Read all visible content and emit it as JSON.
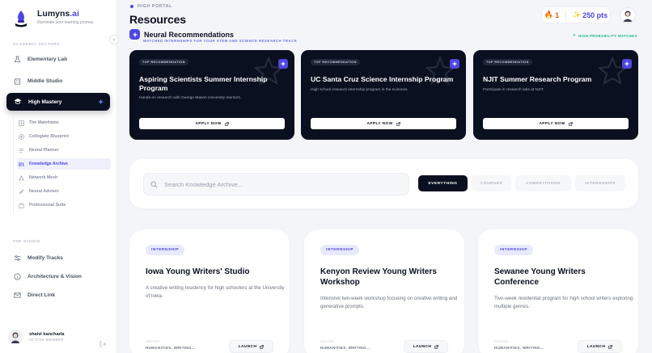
{
  "brand": {
    "name": "Lumyns",
    "name_suffix": ".ai",
    "tagline": "Illuminate your learning journey"
  },
  "sidebar": {
    "section_academic": "ACADEMIC SECTORS",
    "items": [
      {
        "label": "Elementary Lab",
        "icon": "flask-icon"
      },
      {
        "label": "Middle Studio",
        "icon": "building-icon"
      },
      {
        "label": "High Mastery",
        "icon": "graduation-cap-icon"
      }
    ],
    "sub_items": [
      {
        "label": "The Mainframe",
        "icon": "grid-icon"
      },
      {
        "label": "Collegiate Blueprint",
        "icon": "target-icon"
      },
      {
        "label": "Neural Planner",
        "icon": "lines-icon"
      },
      {
        "label": "Knowledge Archive",
        "icon": "books-icon"
      },
      {
        "label": "Network Mesh",
        "icon": "network-icon"
      },
      {
        "label": "Neural Advisor",
        "icon": "compass-icon"
      },
      {
        "label": "Professional Suite",
        "icon": "briefcase-icon"
      }
    ],
    "section_studio": "THE STUDIO",
    "studio_items": [
      {
        "label": "Modify Tracks",
        "icon": "sliders-icon"
      },
      {
        "label": "Architecture & Vision",
        "icon": "info-icon"
      },
      {
        "label": "Direct Link",
        "icon": "mail-icon"
      }
    ],
    "user": {
      "name": "shaivi kancharla",
      "role": "ACTIVE MEMBER"
    }
  },
  "header": {
    "breadcrumb": "HIGH PORTAL",
    "title": "Resources",
    "streak": "1",
    "points": "250 pts"
  },
  "recommendations": {
    "title": "Neural Recommendations",
    "subtitle": "MATCHED INTERNSHIPS FOR YOUR STEM AND SCIENCE RESEARCH TRACK",
    "probability_tag": "HIGH PROBABILITY MATCHES",
    "cards": [
      {
        "tag": "TOP RECOMMENDATION",
        "title": "Aspiring Scientists Summer Internship Program",
        "description": "Hands-on research with George Mason University mentors.",
        "apply": "APPLY NOW"
      },
      {
        "tag": "TOP RECOMMENDATION",
        "title": "UC Santa Cruz Science Internship Program",
        "description": "High school research internship program in the sciences.",
        "apply": "APPLY NOW"
      },
      {
        "tag": "TOP RECOMMENDATION",
        "title": "NJIT Summer Research Program",
        "description": "Participate in research labs at NJIT.",
        "apply": "APPLY NOW"
      }
    ]
  },
  "search": {
    "placeholder": "Search Knowledge Archive...",
    "filters": [
      "EVERYTHING",
      "COURSES",
      "COMPETITIONS",
      "INTERNSHIPS"
    ],
    "active_filter": "EVERYTHING"
  },
  "resources": [
    {
      "category": "INTERNSHIP",
      "title": "Iowa Young Writers' Studio",
      "description": "A creative writing residency for high schoolers at the University of Iowa.",
      "sector_label": "SECTOR",
      "sector": "HUMANITIES, WRITING...",
      "action": "LAUNCH"
    },
    {
      "category": "INTERNSHIP",
      "title": "Kenyon Review Young Writers Workshop",
      "description": "Intensive two-week workshop focusing on creative writing and generative prompts.",
      "sector_label": "SECTOR",
      "sector": "HUMANITIES, WRITING...",
      "action": "LAUNCH"
    },
    {
      "category": "INTERNSHIP",
      "title": "Sewanee Young Writers Conference",
      "description": "Two-week residential program for high school writers exploring multiple genres.",
      "sector_label": "SECTOR",
      "sector": "HUMANITIES, WRITING...",
      "action": "LAUNCH"
    }
  ],
  "colors": {
    "accent": "#4f46e5",
    "dark": "#0b1020",
    "success": "#10b981",
    "streak": "#ea580c"
  }
}
